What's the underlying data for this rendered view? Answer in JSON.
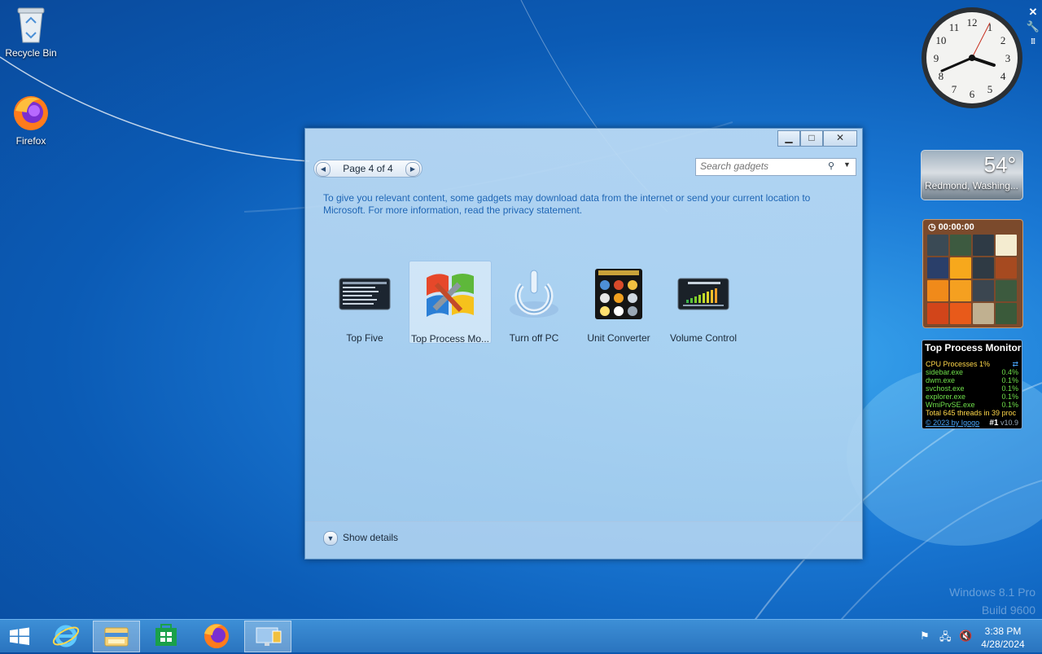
{
  "desktop": {
    "icons": [
      {
        "label": "Recycle Bin"
      },
      {
        "label": "Firefox"
      }
    ],
    "watermark": [
      "Windows 8.1 Pro",
      "Build 9600"
    ]
  },
  "gadget_window": {
    "pager_label": "Page 4 of 4",
    "search_placeholder": "Search gadgets",
    "privacy_text": "To give you relevant content, some gadgets may download data from the internet or send your current location to Microsoft. For more information, read the privacy statement.",
    "gadgets": [
      {
        "name": "Top Five"
      },
      {
        "name": "Top Process Mo..."
      },
      {
        "name": "Turn off PC"
      },
      {
        "name": "Unit Converter"
      },
      {
        "name": "Volume Control"
      }
    ],
    "show_details": "Show details"
  },
  "sidebar": {
    "clock": {
      "numerals": [
        "12",
        "1",
        "2",
        "3",
        "4",
        "5",
        "6",
        "7",
        "8",
        "9",
        "10",
        "11"
      ]
    },
    "weather": {
      "temp": "54°",
      "location": "Redmond, Washing..."
    },
    "puzzle": {
      "timer": "00:00:00"
    },
    "top_process_monitor": {
      "title": "Top Process Monitor",
      "header_label": "CPU Processes 1%",
      "processes": [
        {
          "name": "sidebar.exe",
          "value": "0.4%"
        },
        {
          "name": "dwm.exe",
          "value": "0.1%"
        },
        {
          "name": "svchost.exe",
          "value": "0.1%"
        },
        {
          "name": "explorer.exe",
          "value": "0.1%"
        },
        {
          "name": "WmiPrvSE.exe",
          "value": "0.1%"
        }
      ],
      "total": "Total 645 threads in 39 proc",
      "credit": "© 2023 by Igogo",
      "rank": "#1",
      "version": "v10.9"
    }
  },
  "taskbar": {
    "time": "3:38 PM",
    "date": "4/28/2024"
  },
  "colors": {
    "link_blue": "#1f66b5",
    "tpm_green": "#6fe04a",
    "tpm_yellow": "#ffd84a"
  }
}
